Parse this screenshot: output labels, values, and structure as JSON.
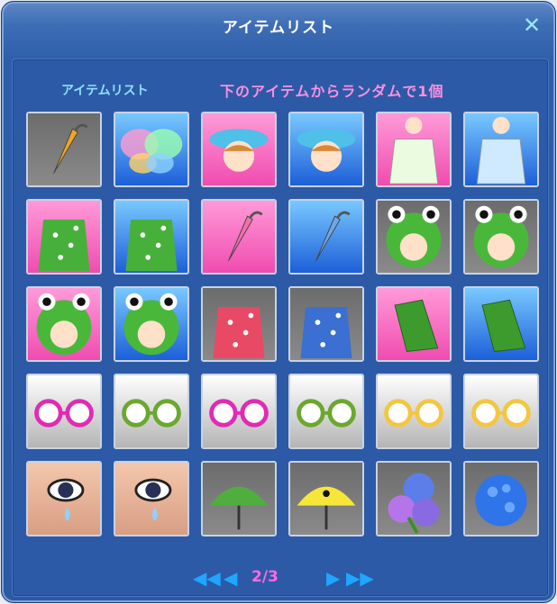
{
  "window": {
    "title": "アイテムリスト",
    "close_symbol": "✕"
  },
  "labels": {
    "left": "アイテムリスト",
    "right": "下のアイテムからランダムで1個"
  },
  "items": [
    {
      "icon": "yellow-umbrella-closed-icon",
      "bg": "gray"
    },
    {
      "icon": "rainbow-butterfly-wings-icon",
      "bg": "blue"
    },
    {
      "icon": "pink-rain-hat-girl-icon",
      "bg": "pink"
    },
    {
      "icon": "blue-rain-hat-boy-icon",
      "bg": "blue"
    },
    {
      "icon": "white-dress-girl-icon",
      "bg": "pink"
    },
    {
      "icon": "light-blue-shirt-boy-icon",
      "bg": "blue"
    },
    {
      "icon": "green-polka-raincoat-girl-icon",
      "bg": "pink"
    },
    {
      "icon": "green-polka-raincoat-boy-icon",
      "bg": "blue"
    },
    {
      "icon": "pink-umbrella-closed-icon",
      "bg": "pink"
    },
    {
      "icon": "blue-umbrella-closed-icon",
      "bg": "blue"
    },
    {
      "icon": "frog-hood-girl-icon",
      "bg": "gray"
    },
    {
      "icon": "frog-hood-boy-icon",
      "bg": "gray"
    },
    {
      "icon": "frog-hood-girl-icon",
      "bg": "pink"
    },
    {
      "icon": "frog-hood-boy-icon",
      "bg": "blue"
    },
    {
      "icon": "red-polka-raincoat-icon",
      "bg": "gray"
    },
    {
      "icon": "blue-polka-raincoat-icon",
      "bg": "gray"
    },
    {
      "icon": "green-gloves-icon",
      "bg": "pink"
    },
    {
      "icon": "green-gloves-icon",
      "bg": "blue"
    },
    {
      "icon": "pink-round-glasses-icon",
      "bg": "white"
    },
    {
      "icon": "green-round-glasses-icon",
      "bg": "white"
    },
    {
      "icon": "pink-sleepy-glasses-icon",
      "bg": "white"
    },
    {
      "icon": "green-sleepy-glasses-icon",
      "bg": "white"
    },
    {
      "icon": "yellow-flower-glasses-icon",
      "bg": "white"
    },
    {
      "icon": "yellow-flower-glasses-icon",
      "bg": "white"
    },
    {
      "icon": "teardrop-eyes-girl-icon",
      "bg": "skin"
    },
    {
      "icon": "teardrop-eyes-boy-icon",
      "bg": "skin"
    },
    {
      "icon": "green-frog-umbrella-icon",
      "bg": "gray"
    },
    {
      "icon": "yellow-chick-umbrella-icon",
      "bg": "gray"
    },
    {
      "icon": "hydrangea-bouquet-icon",
      "bg": "gray"
    },
    {
      "icon": "blue-hydrangea-icon",
      "bg": "gray"
    }
  ],
  "pager": {
    "first": "◀◀",
    "prev": "◀",
    "page": "2/3",
    "next": "▶",
    "last": "▶▶"
  },
  "colors": {
    "panel": "#2c5aa6",
    "title_text": "#ffffff",
    "label_left": "#8fe0ff",
    "label_right": "#ff8fe0",
    "page_text": "#ff6be0",
    "arrow": "#1fa6ff"
  }
}
